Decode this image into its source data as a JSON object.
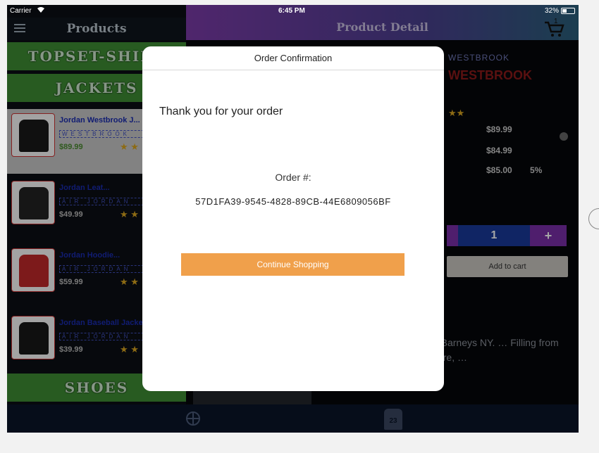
{
  "status_bar": {
    "carrier": "Carrier",
    "time": "6:45 PM",
    "battery": "32%"
  },
  "left_pane": {
    "title": "Products",
    "categories": [
      "TOPSET-SHIRT",
      "JACKETS",
      "SHOES"
    ],
    "products": [
      {
        "name": "Jordan Westbrook J...",
        "brand": "WESTBROOK",
        "price": "$89.99",
        "stars": "★ ★"
      },
      {
        "name": "Jordan Leat...",
        "brand": "AIR JORDAN",
        "price": "$49.99",
        "stars": "★ ★"
      },
      {
        "name": "Jordan Hoodie...",
        "brand": "AIR JORDAN",
        "price": "$59.99",
        "stars": "★ ★"
      },
      {
        "name": "Jordan Baseball Jacket",
        "brand": "AIR JORDAN",
        "price": "$39.99",
        "stars": "★ ★"
      }
    ]
  },
  "right_pane": {
    "title": "Product Detail",
    "cart_count": "1",
    "brand": "WESTBROOK",
    "name": "WESTBROOK",
    "stars": "★★",
    "price1": "$89.99",
    "price2": "$84.99",
    "price3": "$85.00",
    "discount": "5%",
    "qty_minus": "",
    "quantity": "1",
    "qty_plus": "+",
    "add_to_cart": "Add to cart",
    "description": "ket from Jordan … able for Barneys NY. … Filling from natural … ant. Full zip closure, …"
  },
  "tabbar": {
    "jersey_number": "23"
  },
  "modal": {
    "title": "Order Confirmation",
    "thanks": "Thank you for your order",
    "order_label": "Order #:",
    "order_id": "57D1FA39-9545-4828-89CB-44E6809056BF",
    "button": "Continue Shopping"
  },
  "colors": {
    "accent_orange": "#f0a04b",
    "category_green": "#3e8d34",
    "product_blue": "#1a2bb0",
    "qty_purple": "#7a2fa8"
  }
}
